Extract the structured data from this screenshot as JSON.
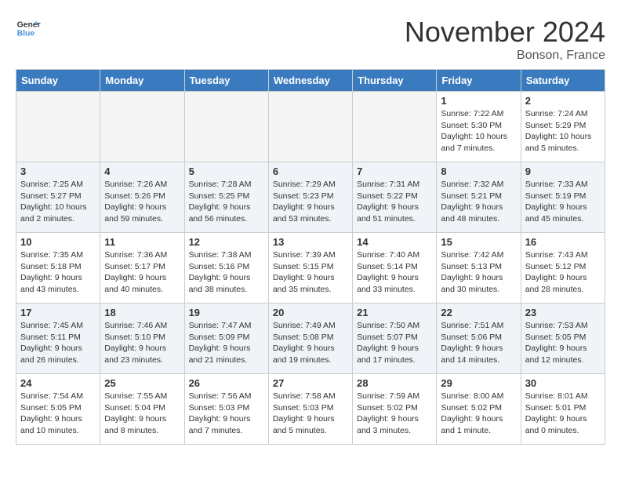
{
  "header": {
    "logo_line1": "General",
    "logo_line2": "Blue",
    "month": "November 2024",
    "location": "Bonson, France"
  },
  "weekdays": [
    "Sunday",
    "Monday",
    "Tuesday",
    "Wednesday",
    "Thursday",
    "Friday",
    "Saturday"
  ],
  "weeks": [
    [
      {
        "day": "",
        "empty": true
      },
      {
        "day": "",
        "empty": true
      },
      {
        "day": "",
        "empty": true
      },
      {
        "day": "",
        "empty": true
      },
      {
        "day": "",
        "empty": true
      },
      {
        "day": "1",
        "sunrise": "Sunrise: 7:22 AM",
        "sunset": "Sunset: 5:30 PM",
        "daylight": "Daylight: 10 hours and 7 minutes."
      },
      {
        "day": "2",
        "sunrise": "Sunrise: 7:24 AM",
        "sunset": "Sunset: 5:29 PM",
        "daylight": "Daylight: 10 hours and 5 minutes."
      }
    ],
    [
      {
        "day": "3",
        "sunrise": "Sunrise: 7:25 AM",
        "sunset": "Sunset: 5:27 PM",
        "daylight": "Daylight: 10 hours and 2 minutes."
      },
      {
        "day": "4",
        "sunrise": "Sunrise: 7:26 AM",
        "sunset": "Sunset: 5:26 PM",
        "daylight": "Daylight: 9 hours and 59 minutes."
      },
      {
        "day": "5",
        "sunrise": "Sunrise: 7:28 AM",
        "sunset": "Sunset: 5:25 PM",
        "daylight": "Daylight: 9 hours and 56 minutes."
      },
      {
        "day": "6",
        "sunrise": "Sunrise: 7:29 AM",
        "sunset": "Sunset: 5:23 PM",
        "daylight": "Daylight: 9 hours and 53 minutes."
      },
      {
        "day": "7",
        "sunrise": "Sunrise: 7:31 AM",
        "sunset": "Sunset: 5:22 PM",
        "daylight": "Daylight: 9 hours and 51 minutes."
      },
      {
        "day": "8",
        "sunrise": "Sunrise: 7:32 AM",
        "sunset": "Sunset: 5:21 PM",
        "daylight": "Daylight: 9 hours and 48 minutes."
      },
      {
        "day": "9",
        "sunrise": "Sunrise: 7:33 AM",
        "sunset": "Sunset: 5:19 PM",
        "daylight": "Daylight: 9 hours and 45 minutes."
      }
    ],
    [
      {
        "day": "10",
        "sunrise": "Sunrise: 7:35 AM",
        "sunset": "Sunset: 5:18 PM",
        "daylight": "Daylight: 9 hours and 43 minutes."
      },
      {
        "day": "11",
        "sunrise": "Sunrise: 7:36 AM",
        "sunset": "Sunset: 5:17 PM",
        "daylight": "Daylight: 9 hours and 40 minutes."
      },
      {
        "day": "12",
        "sunrise": "Sunrise: 7:38 AM",
        "sunset": "Sunset: 5:16 PM",
        "daylight": "Daylight: 9 hours and 38 minutes."
      },
      {
        "day": "13",
        "sunrise": "Sunrise: 7:39 AM",
        "sunset": "Sunset: 5:15 PM",
        "daylight": "Daylight: 9 hours and 35 minutes."
      },
      {
        "day": "14",
        "sunrise": "Sunrise: 7:40 AM",
        "sunset": "Sunset: 5:14 PM",
        "daylight": "Daylight: 9 hours and 33 minutes."
      },
      {
        "day": "15",
        "sunrise": "Sunrise: 7:42 AM",
        "sunset": "Sunset: 5:13 PM",
        "daylight": "Daylight: 9 hours and 30 minutes."
      },
      {
        "day": "16",
        "sunrise": "Sunrise: 7:43 AM",
        "sunset": "Sunset: 5:12 PM",
        "daylight": "Daylight: 9 hours and 28 minutes."
      }
    ],
    [
      {
        "day": "17",
        "sunrise": "Sunrise: 7:45 AM",
        "sunset": "Sunset: 5:11 PM",
        "daylight": "Daylight: 9 hours and 26 minutes."
      },
      {
        "day": "18",
        "sunrise": "Sunrise: 7:46 AM",
        "sunset": "Sunset: 5:10 PM",
        "daylight": "Daylight: 9 hours and 23 minutes."
      },
      {
        "day": "19",
        "sunrise": "Sunrise: 7:47 AM",
        "sunset": "Sunset: 5:09 PM",
        "daylight": "Daylight: 9 hours and 21 minutes."
      },
      {
        "day": "20",
        "sunrise": "Sunrise: 7:49 AM",
        "sunset": "Sunset: 5:08 PM",
        "daylight": "Daylight: 9 hours and 19 minutes."
      },
      {
        "day": "21",
        "sunrise": "Sunrise: 7:50 AM",
        "sunset": "Sunset: 5:07 PM",
        "daylight": "Daylight: 9 hours and 17 minutes."
      },
      {
        "day": "22",
        "sunrise": "Sunrise: 7:51 AM",
        "sunset": "Sunset: 5:06 PM",
        "daylight": "Daylight: 9 hours and 14 minutes."
      },
      {
        "day": "23",
        "sunrise": "Sunrise: 7:53 AM",
        "sunset": "Sunset: 5:05 PM",
        "daylight": "Daylight: 9 hours and 12 minutes."
      }
    ],
    [
      {
        "day": "24",
        "sunrise": "Sunrise: 7:54 AM",
        "sunset": "Sunset: 5:05 PM",
        "daylight": "Daylight: 9 hours and 10 minutes."
      },
      {
        "day": "25",
        "sunrise": "Sunrise: 7:55 AM",
        "sunset": "Sunset: 5:04 PM",
        "daylight": "Daylight: 9 hours and 8 minutes."
      },
      {
        "day": "26",
        "sunrise": "Sunrise: 7:56 AM",
        "sunset": "Sunset: 5:03 PM",
        "daylight": "Daylight: 9 hours and 7 minutes."
      },
      {
        "day": "27",
        "sunrise": "Sunrise: 7:58 AM",
        "sunset": "Sunset: 5:03 PM",
        "daylight": "Daylight: 9 hours and 5 minutes."
      },
      {
        "day": "28",
        "sunrise": "Sunrise: 7:59 AM",
        "sunset": "Sunset: 5:02 PM",
        "daylight": "Daylight: 9 hours and 3 minutes."
      },
      {
        "day": "29",
        "sunrise": "Sunrise: 8:00 AM",
        "sunset": "Sunset: 5:02 PM",
        "daylight": "Daylight: 9 hours and 1 minute."
      },
      {
        "day": "30",
        "sunrise": "Sunrise: 8:01 AM",
        "sunset": "Sunset: 5:01 PM",
        "daylight": "Daylight: 9 hours and 0 minutes."
      }
    ]
  ]
}
